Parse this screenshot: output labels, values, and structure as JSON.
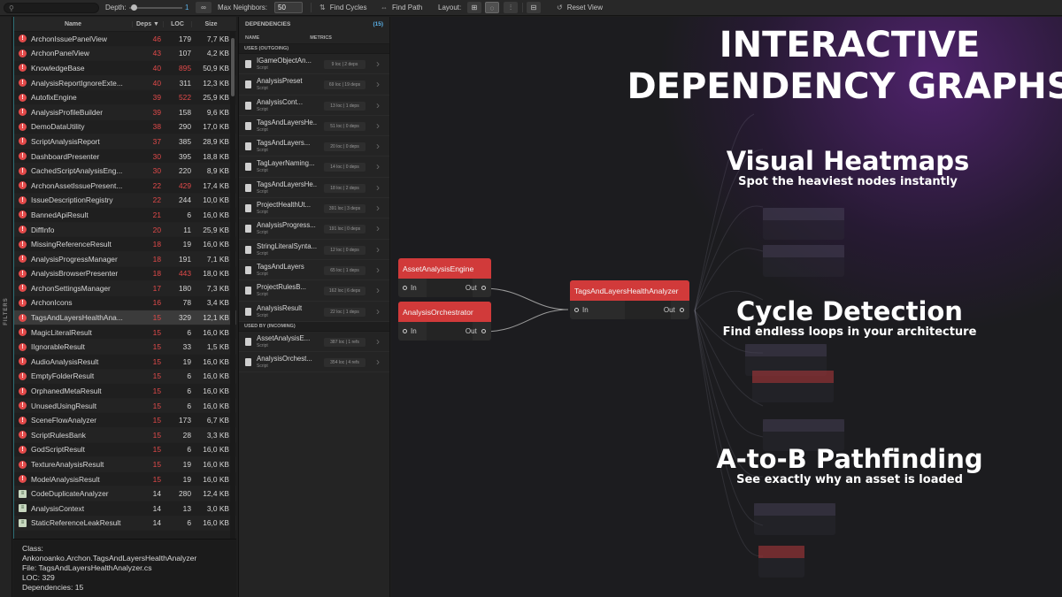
{
  "toolbar": {
    "depth_label": "Depth:",
    "depth_value": "1",
    "inf_label": "∞",
    "max_neighbors_label": "Max Neighbors:",
    "max_neighbors_value": "50",
    "find_cycles": "Find Cycles",
    "find_path": "Find Path",
    "layout_label": "Layout:",
    "reset_view": "Reset View"
  },
  "sidebar": {
    "filters_label": "FILTERS"
  },
  "table": {
    "headers": {
      "name": "Name",
      "deps": "Deps ▼",
      "loc": "LOC",
      "size": "Size"
    },
    "rows": [
      {
        "name": "ArchonIssuePanelView",
        "deps": "46",
        "loc": "179",
        "size": "7,7 KB",
        "icon": "error"
      },
      {
        "name": "ArchonPanelView",
        "deps": "43",
        "loc": "107",
        "size": "4,2 KB",
        "icon": "error"
      },
      {
        "name": "KnowledgeBase",
        "deps": "40",
        "loc": "895",
        "size": "50,9 KB",
        "icon": "error"
      },
      {
        "name": "AnalysisReportIgnoreExte...",
        "deps": "40",
        "loc": "311",
        "size": "12,3 KB",
        "icon": "error"
      },
      {
        "name": "AutofixEngine",
        "deps": "39",
        "loc": "522",
        "size": "25,9 KB",
        "icon": "error"
      },
      {
        "name": "AnalysisProfileBuilder",
        "deps": "39",
        "loc": "158",
        "size": "9,6 KB",
        "icon": "error"
      },
      {
        "name": "DemoDataUtility",
        "deps": "38",
        "loc": "290",
        "size": "17,0 KB",
        "icon": "error"
      },
      {
        "name": "ScriptAnalysisReport",
        "deps": "37",
        "loc": "385",
        "size": "28,9 KB",
        "icon": "error"
      },
      {
        "name": "DashboardPresenter",
        "deps": "30",
        "loc": "395",
        "size": "18,8 KB",
        "icon": "error"
      },
      {
        "name": "CachedScriptAnalysisEng...",
        "deps": "30",
        "loc": "220",
        "size": "8,9 KB",
        "icon": "error"
      },
      {
        "name": "ArchonAssetIssuePresent...",
        "deps": "22",
        "loc": "429",
        "size": "17,4 KB",
        "icon": "error"
      },
      {
        "name": "IssueDescriptionRegistry",
        "deps": "22",
        "loc": "244",
        "size": "10,0 KB",
        "icon": "error"
      },
      {
        "name": "BannedApiResult",
        "deps": "21",
        "loc": "6",
        "size": "16,0 KB",
        "icon": "error"
      },
      {
        "name": "DiffInfo",
        "deps": "20",
        "loc": "11",
        "size": "25,9 KB",
        "icon": "error"
      },
      {
        "name": "MissingReferenceResult",
        "deps": "18",
        "loc": "19",
        "size": "16,0 KB",
        "icon": "error"
      },
      {
        "name": "AnalysisProgressManager",
        "deps": "18",
        "loc": "191",
        "size": "7,1 KB",
        "icon": "error"
      },
      {
        "name": "AnalysisBrowserPresenter",
        "deps": "18",
        "loc": "443",
        "size": "18,0 KB",
        "icon": "error"
      },
      {
        "name": "ArchonSettingsManager",
        "deps": "17",
        "loc": "180",
        "size": "7,3 KB",
        "icon": "error"
      },
      {
        "name": "ArchonIcons",
        "deps": "16",
        "loc": "78",
        "size": "3,4 KB",
        "icon": "error"
      },
      {
        "name": "TagsAndLayersHealthAna...",
        "deps": "15",
        "loc": "329",
        "size": "12,1 KB",
        "icon": "error"
      },
      {
        "name": "MagicLiteralResult",
        "deps": "15",
        "loc": "6",
        "size": "16,0 KB",
        "icon": "error"
      },
      {
        "name": "IIgnorableResult",
        "deps": "15",
        "loc": "33",
        "size": "1,5 KB",
        "icon": "error"
      },
      {
        "name": "AudioAnalysisResult",
        "deps": "15",
        "loc": "19",
        "size": "16,0 KB",
        "icon": "error"
      },
      {
        "name": "EmptyFolderResult",
        "deps": "15",
        "loc": "6",
        "size": "16,0 KB",
        "icon": "error"
      },
      {
        "name": "OrphanedMetaResult",
        "deps": "15",
        "loc": "6",
        "size": "16,0 KB",
        "icon": "error"
      },
      {
        "name": "UnusedUsingResult",
        "deps": "15",
        "loc": "6",
        "size": "16,0 KB",
        "icon": "error"
      },
      {
        "name": "SceneFlowAnalyzer",
        "deps": "15",
        "loc": "173",
        "size": "6,7 KB",
        "icon": "error"
      },
      {
        "name": "ScriptRulesBank",
        "deps": "15",
        "loc": "28",
        "size": "3,3 KB",
        "icon": "error"
      },
      {
        "name": "GodScriptResult",
        "deps": "15",
        "loc": "6",
        "size": "16,0 KB",
        "icon": "error"
      },
      {
        "name": "TextureAnalysisResult",
        "deps": "15",
        "loc": "19",
        "size": "16,0 KB",
        "icon": "error"
      },
      {
        "name": "ModelAnalysisResult",
        "deps": "15",
        "loc": "19",
        "size": "16,0 KB",
        "icon": "error"
      },
      {
        "name": "CodeDuplicateAnalyzer",
        "deps": "14",
        "loc": "280",
        "size": "12,4 KB",
        "icon": "doc"
      },
      {
        "name": "AnalysisContext",
        "deps": "14",
        "loc": "13",
        "size": "3,0 KB",
        "icon": "doc"
      },
      {
        "name": "StaticReferenceLeakResult",
        "deps": "14",
        "loc": "6",
        "size": "16,0 KB",
        "icon": "doc"
      }
    ]
  },
  "info": {
    "class_label": "Class:",
    "class_value": "Ankonoanko.Archon.TagsAndLayersHealthAnalyzer",
    "file_line": "File: TagsAndLayersHealthAnalyzer.cs",
    "loc_line": "LOC: 329",
    "deps_line": "Dependencies: 15"
  },
  "dependencies": {
    "title": "DEPENDENCIES",
    "count": "(15)",
    "col_name": "NAME",
    "col_metrics": "METRICS",
    "outgoing_label": "USES (OUTGOING)",
    "incoming_label": "USED BY (INCOMING)",
    "outgoing": [
      {
        "name": "IGameObjectAn...",
        "type": "Script",
        "metrics": "9 loc | 2 deps"
      },
      {
        "name": "AnalysisPreset",
        "type": "Script",
        "metrics": "69 loc | 19 deps"
      },
      {
        "name": "AnalysisCont...",
        "type": "Script",
        "metrics": "13 loc | 1 deps"
      },
      {
        "name": "TagsAndLayersHe...",
        "type": "Script",
        "metrics": "51 loc | 0 deps"
      },
      {
        "name": "TagsAndLayers...",
        "type": "Script",
        "metrics": "20 loc | 0 deps"
      },
      {
        "name": "TagLayerNaming...",
        "type": "Script",
        "metrics": "14 loc | 0 deps"
      },
      {
        "name": "TagsAndLayersHe...",
        "type": "Script",
        "metrics": "18 loc | 2 deps"
      },
      {
        "name": "ProjectHealthUt...",
        "type": "Script",
        "metrics": "391 loc | 3 deps"
      },
      {
        "name": "AnalysisProgress...",
        "type": "Script",
        "metrics": "191 loc | 0 deps"
      },
      {
        "name": "StringLiteralSynta...",
        "type": "Script",
        "metrics": "12 loc | 0 deps"
      },
      {
        "name": "TagsAndLayers",
        "type": "Script",
        "metrics": "65 loc | 1 deps"
      },
      {
        "name": "ProjectRulesB...",
        "type": "Script",
        "metrics": "162 loc | 6 deps"
      },
      {
        "name": "AnalysisResult",
        "type": "Script",
        "metrics": "22 loc | 1 deps"
      }
    ],
    "incoming": [
      {
        "name": "AssetAnalysisE...",
        "type": "Script",
        "metrics": "387 loc | 1 refs"
      },
      {
        "name": "AnalysisOrchest...",
        "type": "Script",
        "metrics": "354 loc | 4 refs"
      }
    ]
  },
  "graph": {
    "in_label": "In",
    "out_label": "Out",
    "nodes": {
      "asset_engine": "AssetAnalysisEngine",
      "orchestrator": "AnalysisOrchestrator",
      "target": "TagsAndLayersHealthAnalyzer"
    }
  },
  "promo": {
    "title_line1": "INTERACTIVE",
    "title_line2": "DEPENDENCY GRAPHS",
    "heatmaps_title": "Visual Heatmaps",
    "heatmaps_sub": "Spot the heaviest nodes instantly",
    "cycle_title": "Cycle Detection",
    "cycle_sub": "Find endless loops in your architecture",
    "path_title": "A-to-B Pathfinding",
    "path_sub": "See exactly why an asset is loaded"
  },
  "colors": {
    "accent_red": "#d13a3a",
    "accent_blue": "#5ab1e8",
    "glow_purple": "#7828aa"
  }
}
